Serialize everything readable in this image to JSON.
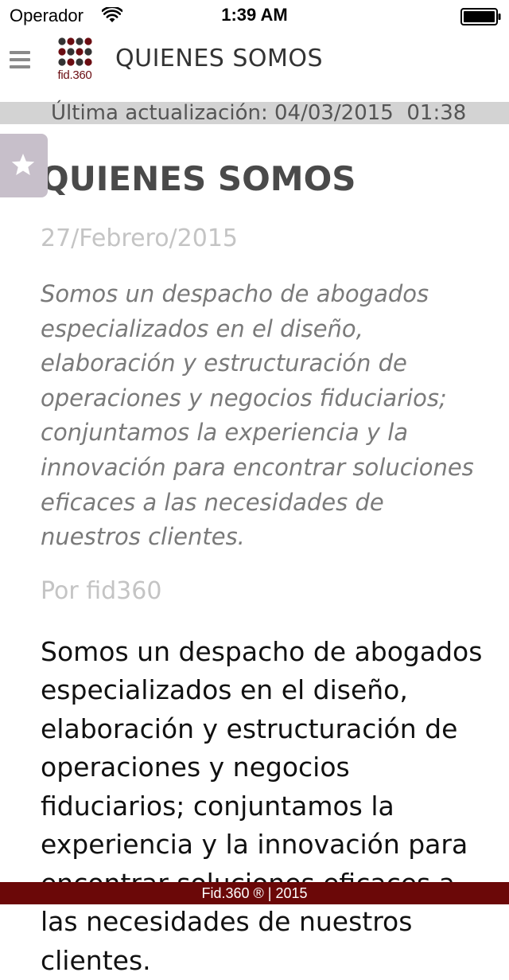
{
  "status_bar": {
    "carrier": "Operador",
    "time": "1:39 AM"
  },
  "nav": {
    "logo_text": "fid.360",
    "title": "QUIENES SOMOS",
    "logo_colors": [
      "#333333",
      "#6b0d12"
    ]
  },
  "update_bar": {
    "text": "Última actualización: 04/03/2015  01:38"
  },
  "article": {
    "title": "QUIENES SOMOS",
    "date": "27/Febrero/2015",
    "summary": "Somos un despacho de abogados especializados en el diseño, elaboración y estructuración de operaciones y negocios fiduciarios; conjuntamos la experiencia y la innovación para encontrar soluciones eficaces a las necesidades de nuestros clientes.",
    "author": "Por fid360",
    "body": "Somos un despacho de abogados especializados en el diseño, elaboración y estructuración de operaciones y negocios fiduciarios; conjuntamos la experiencia y la innovación para encontrar soluciones eficaces a las necesidades de nuestros clientes."
  },
  "favorite": {
    "icon": "star-icon",
    "color": "#c7bfca"
  },
  "footer": {
    "text": "Fid.360 ® | 2015",
    "color": "#6b0808"
  }
}
